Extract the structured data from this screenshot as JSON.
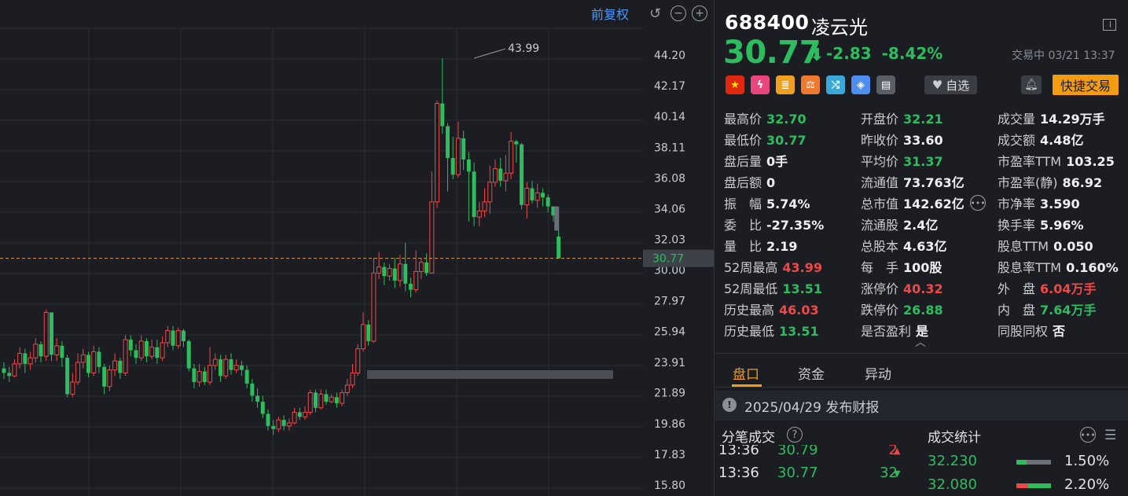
{
  "chart": {
    "restore_label": "前复权",
    "y_ticks": [
      "44.20",
      "42.17",
      "40.14",
      "38.11",
      "36.08",
      "34.06",
      "32.03",
      "30.00",
      "27.97",
      "25.94",
      "23.91",
      "21.89",
      "19.86",
      "17.83",
      "15.80"
    ],
    "high_marker": "43.99",
    "current_price_tag": "30.77",
    "y_range": [
      15.8,
      44.2
    ],
    "current_price": 30.77,
    "colors": {
      "up": "#f04848",
      "down": "#2dbd5e",
      "grid": "#2a2d33",
      "axis_text": "#c9ccd2"
    }
  },
  "quote": {
    "code": "688400",
    "name": "凌云光",
    "price": "30.77",
    "change": "-2.83",
    "change_pct": "-8.42%",
    "status_time": "交易中 03/21 13:37",
    "watch_label": "自选",
    "quick_trade_label": "快捷交易",
    "icons": [
      "cn-flag-icon",
      "margin-icon",
      "database-icon",
      "scale-icon",
      "shuffle-icon",
      "tag-icon",
      "book-icon"
    ]
  },
  "stats": {
    "rows": [
      [
        {
          "l": "最高价",
          "v": "32.70",
          "c": "green"
        },
        {
          "l": "开盘价",
          "v": "32.21",
          "c": "green"
        },
        {
          "l": "成交量",
          "v": "14.29万手",
          "c": "white"
        }
      ],
      [
        {
          "l": "最低价",
          "v": "30.77",
          "c": "green"
        },
        {
          "l": "昨收价",
          "v": "33.60",
          "c": "white"
        },
        {
          "l": "成交额",
          "v": "4.48亿",
          "c": "white"
        }
      ],
      [
        {
          "l": "盘后量",
          "v": "0手",
          "c": "white"
        },
        {
          "l": "平均价",
          "v": "31.37",
          "c": "green"
        },
        {
          "l": "市盈率TTM",
          "v": "103.25",
          "c": "white"
        }
      ],
      [
        {
          "l": "盘后额",
          "v": "0",
          "c": "white"
        },
        {
          "l": "流通值",
          "v": "73.763亿",
          "c": "white"
        },
        {
          "l": "市盈率(静)",
          "v": "86.92",
          "c": "white"
        }
      ],
      [
        {
          "l": "振　幅",
          "v": "5.74%",
          "c": "white"
        },
        {
          "l": "总市值",
          "v": "142.62亿",
          "c": "white"
        },
        {
          "l": "市净率",
          "v": "3.590",
          "c": "white"
        }
      ],
      [
        {
          "l": "委　比",
          "v": "-27.35%",
          "c": "white"
        },
        {
          "l": "流通股",
          "v": "2.4亿",
          "c": "white"
        },
        {
          "l": "换手率",
          "v": "5.96%",
          "c": "white"
        }
      ],
      [
        {
          "l": "量　比",
          "v": "2.19",
          "c": "white"
        },
        {
          "l": "总股本",
          "v": "4.63亿",
          "c": "white"
        },
        {
          "l": "股息TTM",
          "v": "0.050",
          "c": "white"
        }
      ],
      [
        {
          "l": "52周最高",
          "v": "43.99",
          "c": "red"
        },
        {
          "l": "每　手",
          "v": "100股",
          "c": "white"
        },
        {
          "l": "股息率TTM",
          "v": "0.160%",
          "c": "white"
        }
      ],
      [
        {
          "l": "52周最低",
          "v": "13.51",
          "c": "green"
        },
        {
          "l": "涨停价",
          "v": "40.32",
          "c": "red"
        },
        {
          "l": "外　盘",
          "v": "6.04万手",
          "c": "red"
        }
      ],
      [
        {
          "l": "历史最高",
          "v": "46.03",
          "c": "red"
        },
        {
          "l": "跌停价",
          "v": "26.88",
          "c": "green"
        },
        {
          "l": "内　盘",
          "v": "7.64万手",
          "c": "green"
        }
      ],
      [
        {
          "l": "历史最低",
          "v": "13.51",
          "c": "green"
        },
        {
          "l": "是否盈利",
          "v": "是",
          "c": "white"
        },
        {
          "l": "同股同权",
          "v": "否",
          "c": "white"
        }
      ]
    ]
  },
  "tabs": [
    "盘口",
    "资金",
    "异动"
  ],
  "notice": "2025/04/29  发布财报",
  "ticks": {
    "title": "分笔成交",
    "rows": [
      {
        "time": "13:36",
        "price": "30.79",
        "vol": "2",
        "dir": "up"
      },
      {
        "time": "13:36",
        "price": "30.77",
        "vol": "32",
        "dir": "down"
      }
    ]
  },
  "trade_stats": {
    "title": "成交统计",
    "rows": [
      {
        "price": "32.230",
        "pct": "1.50%",
        "buy_frac": 0.3,
        "sell_frac": 0.0
      },
      {
        "price": "32.080",
        "pct": "2.20%",
        "buy_frac": 0.65,
        "sell_frac": 0.35
      }
    ]
  }
}
